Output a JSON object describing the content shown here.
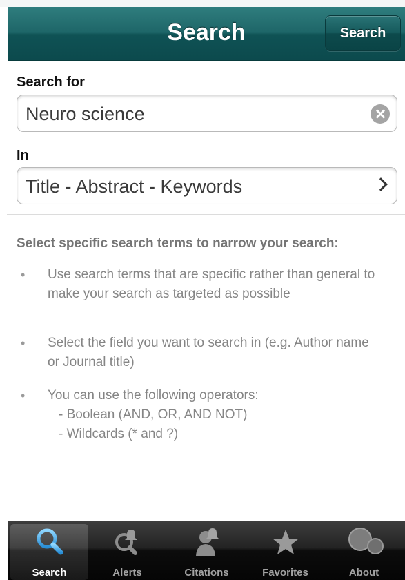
{
  "nav": {
    "title": "Search",
    "action_label": "Search"
  },
  "form": {
    "search_for_label": "Search for",
    "search_value": "Neuro science",
    "in_label": "In",
    "in_value": "Title - Abstract - Keywords"
  },
  "tips": {
    "heading": "Select specific search terms to narrow your search:",
    "items": [
      {
        "text": "Use search terms that are specific rather than general to make your search as targeted as possible"
      },
      {
        "text": "Select the field you want to search in (e.g. Author name or Journal title)"
      },
      {
        "text": "You can use the following operators:",
        "sub": [
          "- Boolean (AND, OR, AND NOT)",
          "- Wildcards (* and ?)"
        ]
      }
    ]
  },
  "tabbar": {
    "tabs": [
      {
        "label": "Search",
        "icon": "magnifier-icon",
        "selected": true
      },
      {
        "label": "Alerts",
        "icon": "alert-bell-icon",
        "selected": false
      },
      {
        "label": "Citations",
        "icon": "citation-person-icon",
        "selected": false
      },
      {
        "label": "Favorites",
        "icon": "star-icon",
        "selected": false
      },
      {
        "label": "About",
        "icon": "about-circles-icon",
        "selected": false
      }
    ]
  },
  "colors": {
    "navbar": "#1e6668",
    "selected_icon": "#4fb3e8"
  }
}
